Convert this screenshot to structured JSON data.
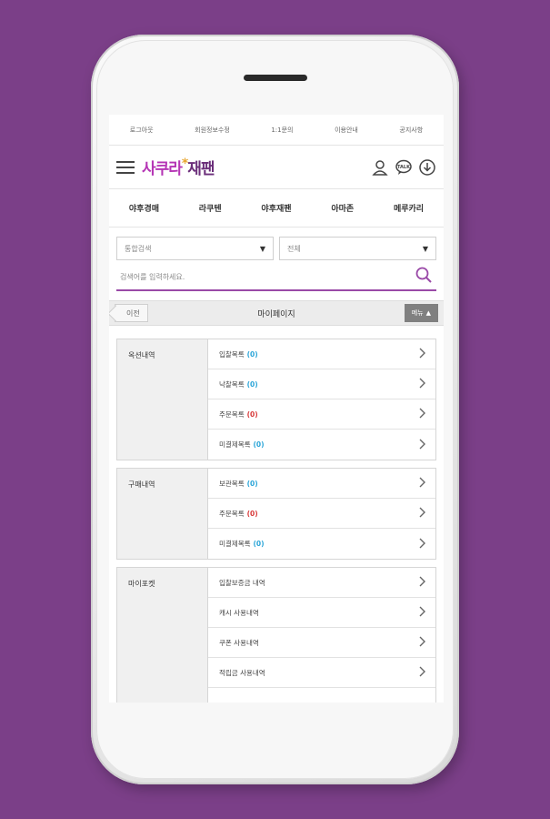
{
  "colors": {
    "background": "#7b3f88",
    "accent": "#9a4aa8",
    "count_blue": "#2aa5d8",
    "count_red": "#d83a3a"
  },
  "util_bar": [
    "로그아웃",
    "회원정보수정",
    "1:1문의",
    "이용안내",
    "공지사항"
  ],
  "logo": {
    "part1": "사쿠라",
    "star": "*",
    "part2": "재팬"
  },
  "header_icons": [
    "user-icon",
    "talk-icon",
    "download-icon"
  ],
  "categories": [
    "야후경매",
    "라쿠텐",
    "야후재팬",
    "아마존",
    "메루카리"
  ],
  "search": {
    "select1": "통합검색",
    "select2": "전체",
    "placeholder": "검색어를 입력하세요."
  },
  "title_bar": {
    "back": "이전",
    "title": "마이페이지",
    "menu": "메뉴"
  },
  "sections": [
    {
      "label": "옥션내역",
      "items": [
        {
          "label": "입찰목록",
          "count": "(0)",
          "count_color": "blue"
        },
        {
          "label": "낙찰목록",
          "count": "(0)",
          "count_color": "blue"
        },
        {
          "label": "주문목록",
          "count": "(0)",
          "count_color": "red"
        },
        {
          "label": "미결제목록",
          "count": "(0)",
          "count_color": "blue"
        }
      ]
    },
    {
      "label": "구매내역",
      "items": [
        {
          "label": "보관목록",
          "count": "(0)",
          "count_color": "blue"
        },
        {
          "label": "주문목록",
          "count": "(0)",
          "count_color": "red"
        },
        {
          "label": "미결제목록",
          "count": "(0)",
          "count_color": "blue"
        }
      ]
    },
    {
      "label": "마이포켓",
      "items": [
        {
          "label": "입찰보증금 내역"
        },
        {
          "label": "캐시 사용내역"
        },
        {
          "label": "쿠폰 사용내역"
        },
        {
          "label": "적립금 사용내역"
        },
        {
          "label": ""
        }
      ]
    }
  ]
}
